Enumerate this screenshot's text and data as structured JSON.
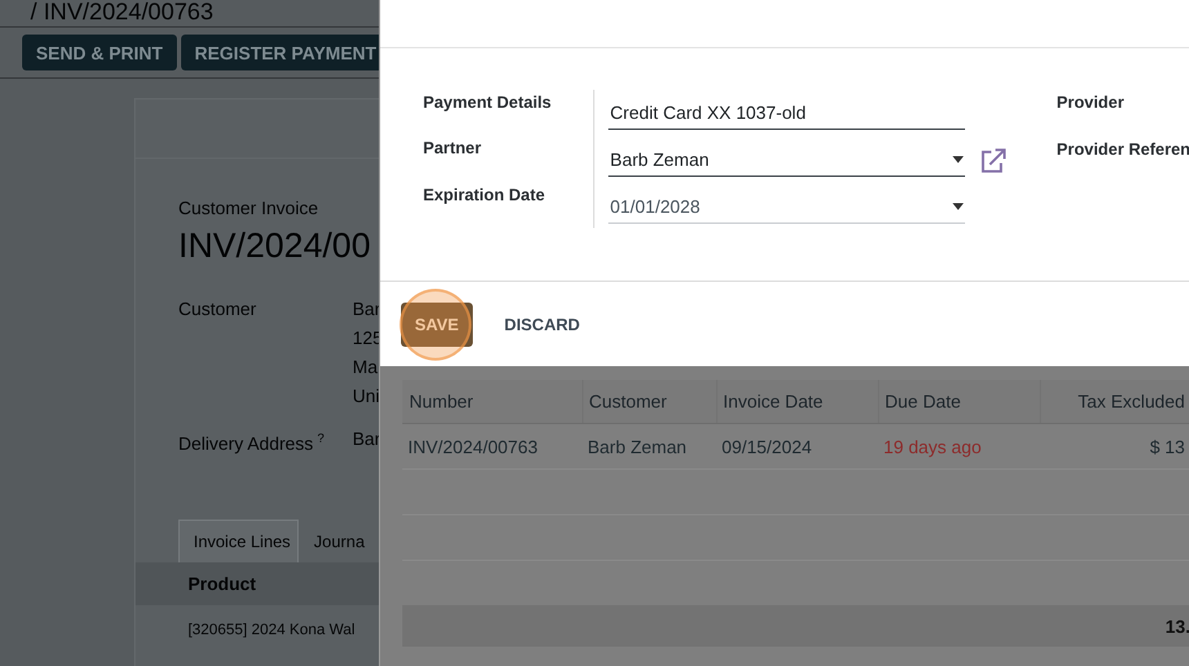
{
  "breadcrumb": "/ INV/2024/00763",
  "actions": [
    {
      "label": "SEND & PRINT"
    },
    {
      "label": "REGISTER PAYMENT"
    }
  ],
  "invoice": {
    "type_label": "Customer Invoice",
    "number": "INV/2024/00",
    "fields": [
      {
        "label": "Customer",
        "lines": [
          "Bar",
          "125",
          "Ma",
          "Uni"
        ]
      },
      {
        "label": "Delivery Address",
        "help": "?",
        "lines": [
          "Bar"
        ]
      }
    ],
    "tabs": [
      {
        "label": "Invoice Lines",
        "selected": true
      },
      {
        "label": "Journa",
        "selected": false
      }
    ],
    "lines_table": {
      "columns": [
        "Product"
      ],
      "rows": [
        [
          "[320655] 2024 Kona Wal"
        ]
      ]
    }
  },
  "dialog": {
    "fields": [
      {
        "label": "Payment Details",
        "value": "Credit Card XX 1037-old",
        "kind": "text"
      },
      {
        "label": "Partner",
        "value": "Barb Zeman",
        "kind": "relation"
      },
      {
        "label": "Expiration Date",
        "value": "01/01/2028",
        "kind": "select"
      }
    ],
    "side_labels": [
      "Provider",
      "Provider Referen"
    ],
    "buttons": [
      {
        "label": "SAVE",
        "kind": "primary",
        "highlighted": true
      },
      {
        "label": "DISCARD",
        "kind": "secondary",
        "highlighted": false
      }
    ]
  },
  "invoices_table": {
    "columns": [
      "Number",
      "Customer",
      "Invoice Date",
      "Due Date",
      "Tax Excluded"
    ],
    "rows": [
      {
        "cells": [
          "INV/2024/00763",
          "Barb Zeman",
          "09/15/2024",
          "19 days ago",
          "$ 13"
        ],
        "overdue": true
      }
    ],
    "total": "13."
  }
}
